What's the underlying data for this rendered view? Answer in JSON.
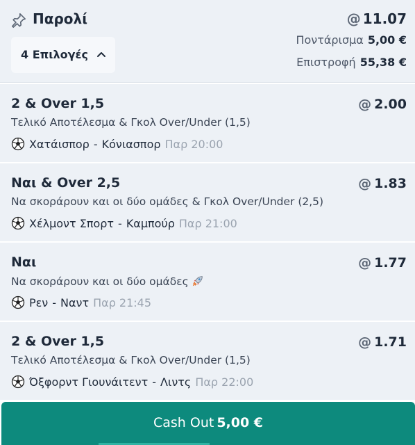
{
  "header": {
    "title": "Παρολί",
    "odds_at": "@",
    "total_odds": "11.07",
    "selections_label": "4 Επιλογές",
    "stake_label": "Ποντάρισμα",
    "stake_value": "5,00 €",
    "return_label": "Επιστροφή",
    "return_value": "55,38 €"
  },
  "selections": [
    {
      "title": "2 & Over 1,5",
      "odds": "2.00",
      "market": "Τελικό Αποτέλεσμα & Γκολ Over/Under (1,5)",
      "home": "Χατάισπορ",
      "away": "Κόνιασπορ",
      "kickoff": "Παρ 20:00"
    },
    {
      "title": "Ναι & Over 2,5",
      "odds": "1.83",
      "market": "Να σκοράρουν και οι δύο ομάδες & Γκολ Over/Under (2,5)",
      "home": "Χέλμοντ Σπορτ",
      "away": "Καμπούρ",
      "kickoff": "Παρ 21:00"
    },
    {
      "title": "Ναι",
      "odds": "1.77",
      "market": "Να σκοράρουν και οι δύο ομάδες",
      "home": "Ρεν",
      "away": "Ναντ",
      "kickoff": "Παρ 21:45"
    },
    {
      "title": "2 & Over 1,5",
      "odds": "1.71",
      "market": "Τελικό Αποτέλεσμα & Γκολ Over/Under (1,5)",
      "home": "Όξφορντ Γιουνάιτεντ",
      "away": "Λιντς",
      "kickoff": "Παρ 22:00"
    }
  ],
  "separator": "-",
  "cashout": {
    "label": "Cash Out",
    "amount": "5,00 €"
  },
  "icons": {
    "pin": "pin-icon",
    "chevron": "chevron-up-icon",
    "sport": "soccer-ball-icon",
    "boost": "rocket-icon"
  },
  "colors": {
    "panel": "#edf1f6",
    "cashout": "#0d8a7d",
    "text": "#1f2a3a",
    "muted": "#9aa3af"
  }
}
